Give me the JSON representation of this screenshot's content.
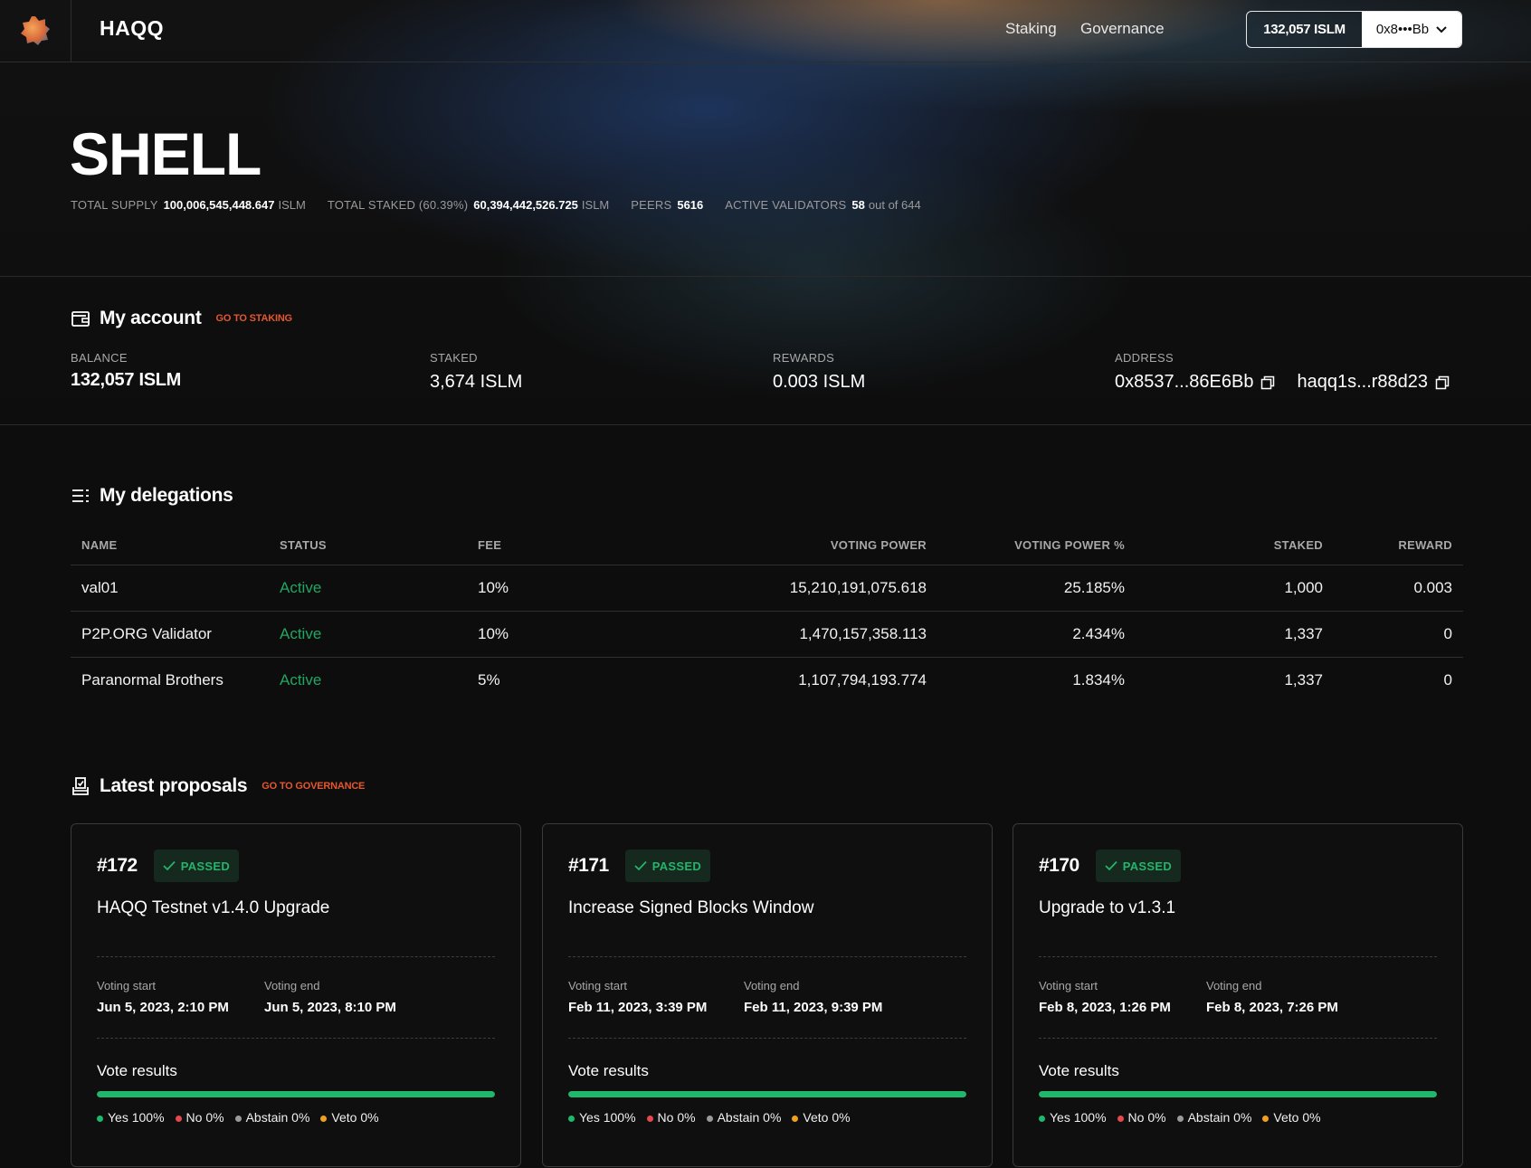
{
  "header": {
    "brand": "HAQQ",
    "nav": {
      "staking": "Staking",
      "governance": "Governance"
    },
    "wallet": {
      "balance": "132,057 ISLM",
      "address": "0x8•••Bb"
    }
  },
  "hero": {
    "title": "SHELL",
    "stats": {
      "total_supply_label": "TOTAL SUPPLY",
      "total_supply_value": "100,006,545,448.647",
      "total_supply_unit": "ISLM",
      "total_staked_label": "TOTAL STAKED (60.39%)",
      "total_staked_value": "60,394,442,526.725",
      "total_staked_unit": "ISLM",
      "peers_label": "PEERS",
      "peers_value": "5616",
      "validators_label": "ACTIVE VALIDATORS",
      "validators_value": "58",
      "validators_suffix": "out of 644"
    }
  },
  "account": {
    "title": "My account",
    "link": "GO TO STAKING",
    "balance_label": "BALANCE",
    "balance_value": "132,057 ISLM",
    "staked_label": "STAKED",
    "staked_value": "3,674 ISLM",
    "rewards_label": "REWARDS",
    "rewards_value": "0.003 ISLM",
    "address_label": "ADDRESS",
    "address_eth": "0x8537...86E6Bb",
    "address_haqq": "haqq1s...r88d23"
  },
  "delegations": {
    "title": "My delegations",
    "columns": [
      "NAME",
      "STATUS",
      "FEE",
      "VOTING POWER",
      "VOTING POWER %",
      "STAKED",
      "REWARD"
    ],
    "rows": [
      {
        "name": "val01",
        "status": "Active",
        "fee": "10%",
        "voting_power": "15,210,191,075.618",
        "voting_power_pct": "25.185%",
        "staked": "1,000",
        "reward": "0.003"
      },
      {
        "name": "P2P.ORG Validator",
        "status": "Active",
        "fee": "10%",
        "voting_power": "1,470,157,358.113",
        "voting_power_pct": "2.434%",
        "staked": "1,337",
        "reward": "0"
      },
      {
        "name": "Paranormal Brothers",
        "status": "Active",
        "fee": "5%",
        "voting_power": "1,107,794,193.774",
        "voting_power_pct": "1.834%",
        "staked": "1,337",
        "reward": "0"
      }
    ]
  },
  "proposals": {
    "title": "Latest proposals",
    "link": "GO TO GOVERNANCE",
    "voting_start_label": "Voting start",
    "voting_end_label": "Voting end",
    "vote_results_label": "Vote results",
    "colors": {
      "yes": "#1fb86a",
      "no": "#e5484d",
      "abstain": "#9a9a9a",
      "veto": "#f0a020"
    },
    "items": [
      {
        "num": "#172",
        "status": "PASSED",
        "title": "HAQQ Testnet v1.4.0 Upgrade",
        "voting_start": "Jun 5, 2023, 2:10 PM",
        "voting_end": "Jun 5, 2023, 8:10 PM",
        "yes": "Yes 100%",
        "no": "No 0%",
        "abstain": "Abstain 0%",
        "veto": "Veto 0%",
        "yes_fraction": 1.0
      },
      {
        "num": "#171",
        "status": "PASSED",
        "title": "Increase Signed Blocks Window",
        "voting_start": "Feb 11, 2023, 3:39 PM",
        "voting_end": "Feb 11, 2023, 9:39 PM",
        "yes": "Yes 100%",
        "no": "No 0%",
        "abstain": "Abstain 0%",
        "veto": "Veto 0%",
        "yes_fraction": 1.0
      },
      {
        "num": "#170",
        "status": "PASSED",
        "title": "Upgrade to v1.3.1",
        "voting_start": "Feb 8, 2023, 1:26 PM",
        "voting_end": "Feb 8, 2023, 7:26 PM",
        "yes": "Yes 100%",
        "no": "No 0%",
        "abstain": "Abstain 0%",
        "veto": "Veto 0%",
        "yes_fraction": 1.0
      }
    ]
  }
}
